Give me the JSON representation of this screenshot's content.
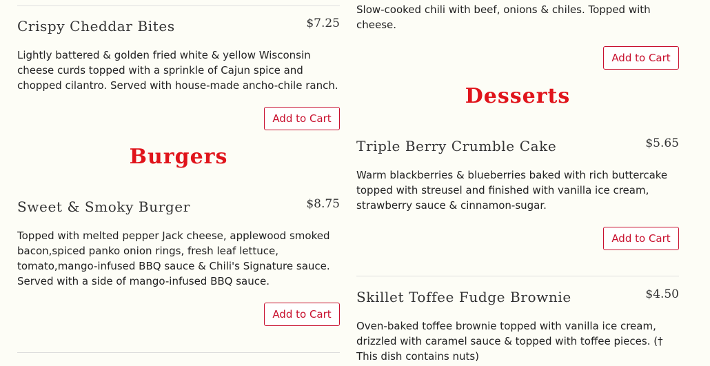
{
  "left_column": {
    "appetizer": {
      "name": "Crispy Cheddar Bites",
      "price": "$7.25",
      "description": "Lightly battered & golden fried white & yellow Wisconsin cheese curds topped with a sprinkle of Cajun spice and chopped cilantro. Served with house-made ancho-chile ranch.",
      "button_label": "Add to Cart"
    },
    "section_title": "Burgers",
    "burger": {
      "name": "Sweet & Smoky Burger",
      "price": "$8.75",
      "description": "Topped with melted pepper Jack cheese, applewood smoked bacon,spiced panko onion rings, fresh leaf lettuce, tomato,mango-infused BBQ sauce & Chili's Signature sauce. Served with a side of mango-infused BBQ sauce.",
      "button_label": "Add to Cart"
    }
  },
  "right_column": {
    "chili": {
      "description": "Slow-cooked chili with beef, onions & chiles. Topped with cheese.",
      "button_label": "Add to Cart"
    },
    "section_title": "Desserts",
    "cake": {
      "name": "Triple Berry Crumble Cake",
      "price": "$5.65",
      "description": "Warm blackberries & blueberries baked with rich buttercake topped with streusel and finished with vanilla ice cream, strawberry sauce & cinnamon-sugar.",
      "button_label": "Add to Cart"
    },
    "brownie": {
      "name": "Skillet Toffee Fudge Brownie",
      "price": "$4.50",
      "description": "Oven-baked toffee brownie topped with vanilla ice cream, drizzled with caramel sauce & topped with toffee pieces. († This dish contains nuts)"
    }
  },
  "colors": {
    "accent_red": "#e0141b",
    "button_red": "#c8102e",
    "background": "#fdfdf6"
  }
}
